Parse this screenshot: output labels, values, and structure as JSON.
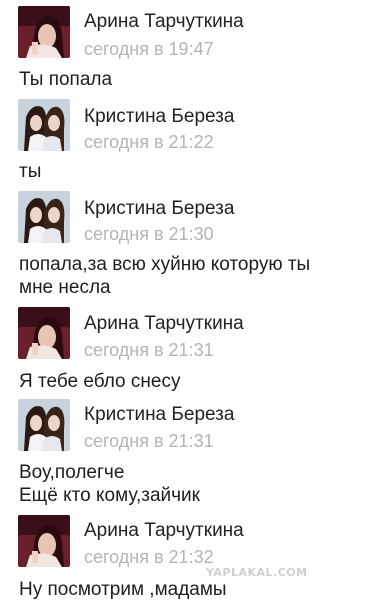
{
  "messages": [
    {
      "author": "Арина Тарчуткина",
      "time": "сегодня в 19:47",
      "text": "Ты попала",
      "avatar": "avatar-arina"
    },
    {
      "author": "Кристина Береза",
      "time": "сегодня в 21:22",
      "text": "ты",
      "avatar": "avatar-kristina"
    },
    {
      "author": "Кристина Береза",
      "time": "сегодня в 21:30",
      "text": "попала,за всю хуйню которую ты\nмне несла",
      "avatar": "avatar-kristina"
    },
    {
      "author": "Арина Тарчуткина",
      "time": "сегодня в 21:31",
      "text": "Я тебе ебло снесу",
      "avatar": "avatar-arina"
    },
    {
      "author": "Кристина Береза",
      "time": "сегодня в 21:31",
      "text": "Воу,полегче\nЕщё кто кому,зайчик",
      "avatar": "avatar-kristina"
    },
    {
      "author": "Арина Тарчуткина",
      "time": "сегодня в 21:32",
      "text": "Ну посмотрим ,мадамы",
      "avatar": "avatar-arina"
    }
  ],
  "watermark": "YAPLAKAL.COM",
  "colors": {
    "name": "#222222",
    "time": "#b4b4b4",
    "text": "#1e1e1e",
    "background": "#ffffff"
  }
}
